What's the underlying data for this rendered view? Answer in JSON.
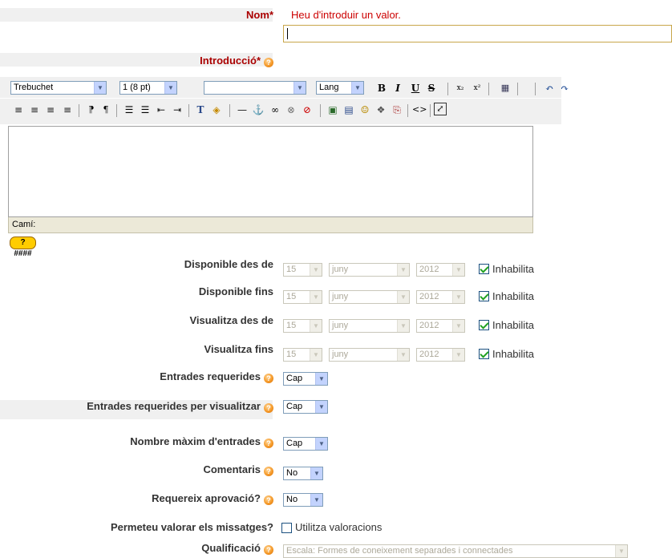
{
  "form": {
    "name": {
      "label": "Nom",
      "required_mark": "*",
      "error": "Heu d'introduir un valor.",
      "value": ""
    },
    "intro": {
      "label": "Introducció",
      "required_mark": "*",
      "help_icon": "help-icon"
    },
    "editor": {
      "font": "Trebuchet",
      "size": "1 (8 pt)",
      "style": "",
      "lang": "Lang",
      "path_label": "Camí:",
      "shortcut_label": "? ####",
      "row1_buttons": [
        {
          "name": "bold-icon",
          "glyph": "B"
        },
        {
          "name": "italic-icon",
          "glyph": "I"
        },
        {
          "name": "underline-icon",
          "glyph": "U"
        },
        {
          "name": "strikethrough-icon",
          "glyph": "S"
        },
        {
          "name": "subscript-icon",
          "glyph": "x₂"
        },
        {
          "name": "superscript-icon",
          "glyph": "x²"
        },
        {
          "name": "clean-word-icon",
          "glyph": "▦"
        },
        {
          "name": "undo-icon",
          "glyph": "↶"
        },
        {
          "name": "redo-icon",
          "glyph": "↷"
        }
      ],
      "row2_buttons": [
        {
          "name": "align-left-icon",
          "glyph": "≡"
        },
        {
          "name": "align-center-icon",
          "glyph": "≡"
        },
        {
          "name": "align-right-icon",
          "glyph": "≡"
        },
        {
          "name": "justify-icon",
          "glyph": "≡"
        },
        {
          "name": "ltr-icon",
          "glyph": "⁋"
        },
        {
          "name": "rtl-icon",
          "glyph": "¶"
        },
        {
          "name": "ordered-list-icon",
          "glyph": "☰"
        },
        {
          "name": "unordered-list-icon",
          "glyph": "☰"
        },
        {
          "name": "outdent-icon",
          "glyph": "⇤"
        },
        {
          "name": "indent-icon",
          "glyph": "⇥"
        },
        {
          "name": "text-color-icon",
          "glyph": "T"
        },
        {
          "name": "bg-color-icon",
          "glyph": "◈"
        },
        {
          "name": "horizontal-rule-icon",
          "glyph": "—"
        },
        {
          "name": "anchor-icon",
          "glyph": "⚓"
        },
        {
          "name": "link-icon",
          "glyph": "∞"
        },
        {
          "name": "unlink-icon",
          "glyph": "⊗"
        },
        {
          "name": "nolink-icon",
          "glyph": "⊘"
        },
        {
          "name": "image-icon",
          "glyph": "▣"
        },
        {
          "name": "table-icon",
          "glyph": "▤"
        },
        {
          "name": "smiley-icon",
          "glyph": "☺"
        },
        {
          "name": "special-char-icon",
          "glyph": "❖"
        },
        {
          "name": "search-replace-icon",
          "glyph": "⎘"
        },
        {
          "name": "html-source-icon",
          "glyph": "<>"
        },
        {
          "name": "fullscreen-icon",
          "glyph": "⤢"
        }
      ]
    },
    "dates": [
      {
        "label": "Disponible des de",
        "day": "15",
        "month": "juny",
        "year": "2012",
        "disable_label": "Inhabilita",
        "disabled": true
      },
      {
        "label": "Disponible fins",
        "day": "15",
        "month": "juny",
        "year": "2012",
        "disable_label": "Inhabilita",
        "disabled": true
      },
      {
        "label": "Visualitza des de",
        "day": "15",
        "month": "juny",
        "year": "2012",
        "disable_label": "Inhabilita",
        "disabled": true
      },
      {
        "label": "Visualitza fins",
        "day": "15",
        "month": "juny",
        "year": "2012",
        "disable_label": "Inhabilita",
        "disabled": true
      }
    ],
    "required_entries": {
      "label": "Entrades requerides",
      "value": "Cap"
    },
    "required_to_view": {
      "label": "Entrades requerides per visualitzar",
      "value": "Cap"
    },
    "max_entries": {
      "label": "Nombre màxim d'entrades",
      "value": "Cap"
    },
    "comments": {
      "label": "Comentaris",
      "value": "No"
    },
    "approval": {
      "label": "Requereix aprovació?",
      "value": "No"
    },
    "ratings": {
      "label": "Permeteu valorar els missatges?",
      "checkbox_label": "Utilitza valoracions",
      "checked": false
    },
    "grade": {
      "label": "Qualificació",
      "value": "Escala: Formes de coneixement separades i connectades"
    }
  },
  "colors": {
    "required": "#aa0000",
    "error": "#cc0000",
    "help": "#f59a2a"
  }
}
